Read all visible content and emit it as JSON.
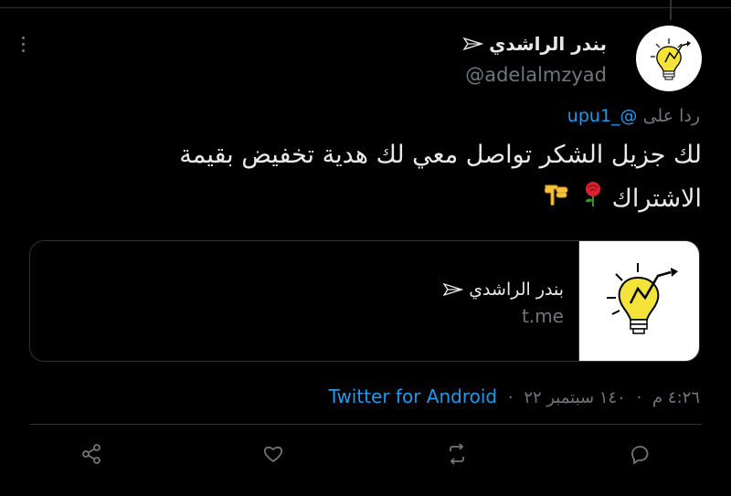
{
  "author": {
    "name": "بندر الراشدي",
    "handle": "@adelalmzyad",
    "badge_icon": "paper-plane-icon"
  },
  "reply": {
    "prefix": "ردا على",
    "mention": "@_upu1"
  },
  "tweet": {
    "line1": "لك جزيل الشكر تواصل معي لك هدية تخفيض بقيمة",
    "line2": "الاشتراك",
    "emojis": [
      "rose-emoji",
      "pointing-down-hand-emoji"
    ]
  },
  "card": {
    "title": "بندر الراشدي",
    "domain": "t.me",
    "thumbnail_icon": "lightbulb-icon"
  },
  "meta": {
    "time": "٤:٢٦ م",
    "date": "١٤٠ سبتمبر ٢٢",
    "source": "Twitter for Android"
  },
  "actions": [
    "share-icon",
    "like-icon",
    "retweet-icon",
    "reply-icon"
  ],
  "colors": {
    "background": "#000000",
    "text": "#e7e9ea",
    "muted": "#71767b",
    "link": "#1d9bf0",
    "divider": "#2f3336"
  }
}
